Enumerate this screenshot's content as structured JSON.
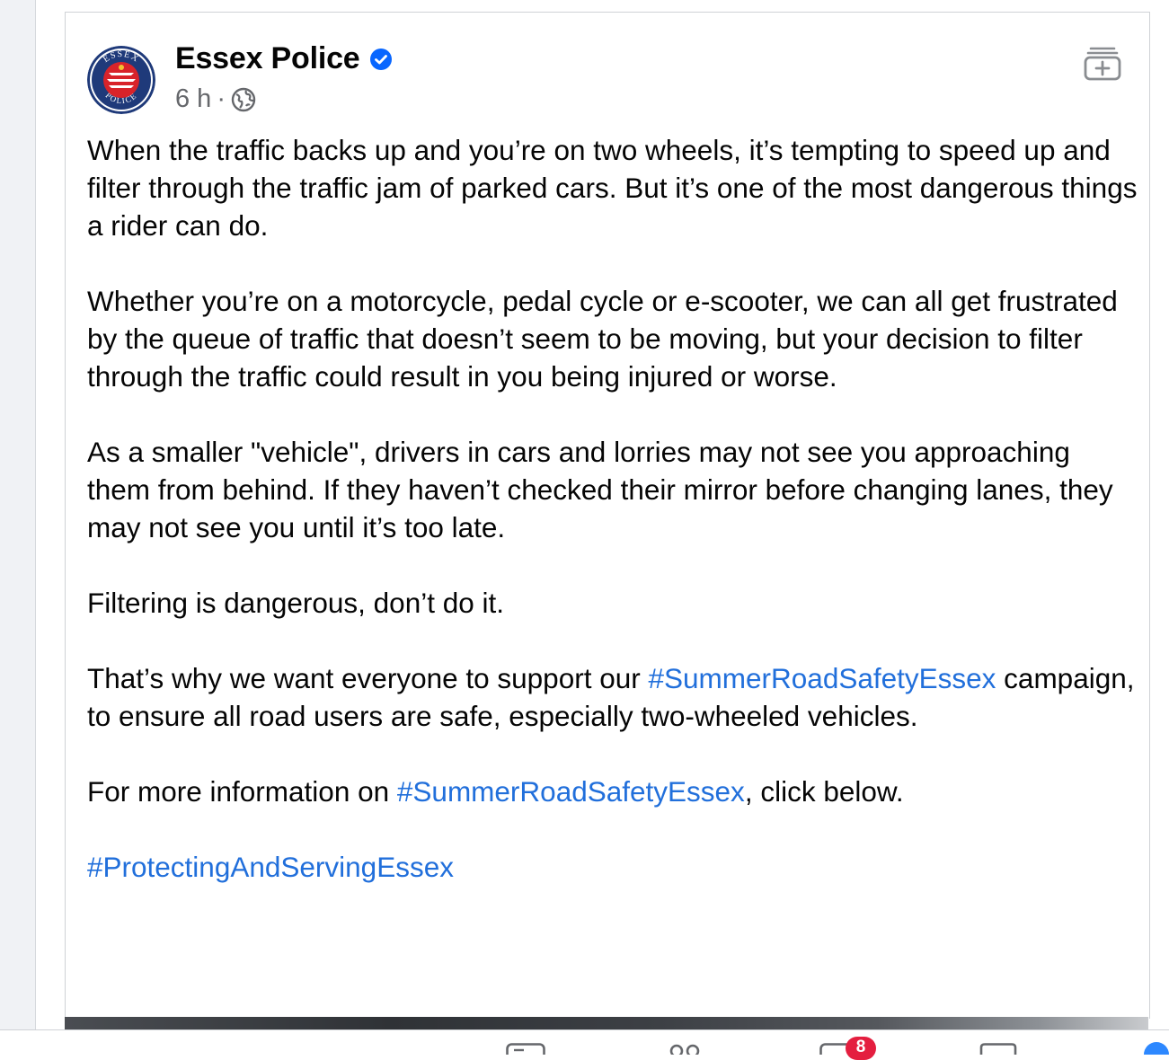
{
  "post": {
    "page_name": "Essex Police",
    "time": "6 h",
    "separator": "·",
    "paragraphs": {
      "p1": "When the traffic backs up and you’re on two wheels, it’s tempting to speed up and filter through the traffic jam of parked cars. But it’s one of the most dangerous things a rider can do.",
      "p2": "Whether you’re on a motorcycle, pedal cycle or e-scooter, we can all get frustrated by the queue of traffic that doesn’t seem to be moving, but your decision to filter through the traffic could result in you being injured or worse.",
      "p3": "As a smaller \"vehicle\", drivers in cars and lorries may not see you approaching them from behind. If they haven’t checked their mirror before changing lanes, they may not see you until it’s too late.",
      "p4": "Filtering is dangerous, don’t do it.",
      "p5_before": "That’s why we want everyone to support our ",
      "p5_hashtag": "#SummerRoadSafetyEssex",
      "p5_after": " campaign, to ensure all road users are safe, especially two-wheeled vehicles.",
      "p6_before": "For more information on ",
      "p6_hashtag": "#SummerRoadSafetyEssex",
      "p6_after": ", click below.",
      "p7_hashtag": "#ProtectingAndServingEssex"
    }
  },
  "avatar": {
    "logo_text_top": "ESSEX",
    "logo_text_bottom": "POLICE"
  },
  "tabbar": {
    "notifications_badge": "8"
  },
  "colors": {
    "hashtag": "#216fdb",
    "verified": "#0866ff",
    "badge": "#e41e3f"
  },
  "icons": {
    "verified": "verified-badge-icon",
    "audience": "globe-icon",
    "save": "save-post-icon"
  }
}
